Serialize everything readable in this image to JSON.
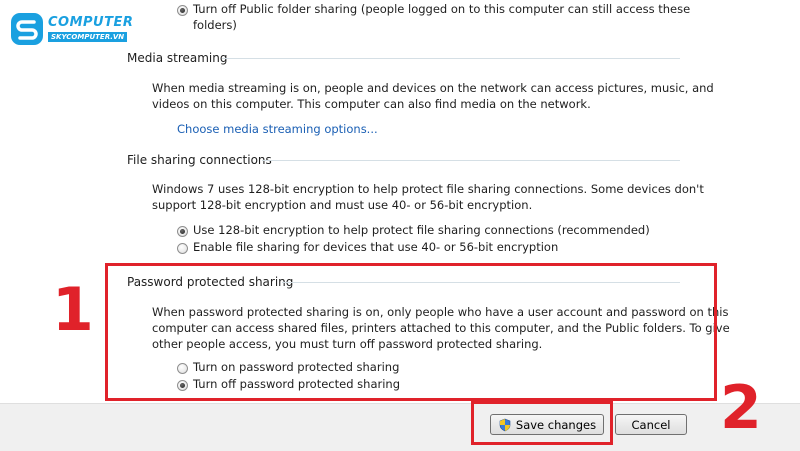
{
  "logo": {
    "word": "COMPUTER",
    "sub": "SKYCOMPUTER.VN",
    "mark": "S"
  },
  "public_folder": {
    "option_line1": "Turn off Public folder sharing (people logged on to this computer can still access these",
    "option_line2": "folders)"
  },
  "media_streaming": {
    "title": "Media streaming",
    "desc_line1": "When media streaming is on, people and devices on the network can access pictures, music, and",
    "desc_line2": "videos on this computer. This computer can also find media on the network.",
    "link": "Choose media streaming options..."
  },
  "file_sharing": {
    "title": "File sharing connections",
    "desc_line1": "Windows 7 uses 128-bit encryption to help protect file sharing connections. Some devices don't",
    "desc_line2": "support 128-bit encryption and must use 40- or 56-bit encryption.",
    "option1": "Use 128-bit encryption to help protect file sharing connections (recommended)",
    "option2": "Enable file sharing for devices that use 40- or 56-bit encryption"
  },
  "password_sharing": {
    "title": "Password protected sharing",
    "desc_line1": "When password protected sharing is on, only people who have a user account and password on this",
    "desc_line2": "computer can access shared files, printers attached to this computer, and the Public folders. To give",
    "desc_line3": "other people access, you must turn off password protected sharing.",
    "option_on": "Turn on password protected sharing",
    "option_off": "Turn off password protected sharing"
  },
  "footer": {
    "save": "Save changes",
    "cancel": "Cancel"
  },
  "annotations": {
    "step1": "1",
    "step2": "2"
  },
  "colors": {
    "highlight": "#e0222a",
    "link": "#1a5fb4",
    "logo": "#1aa0e0"
  }
}
